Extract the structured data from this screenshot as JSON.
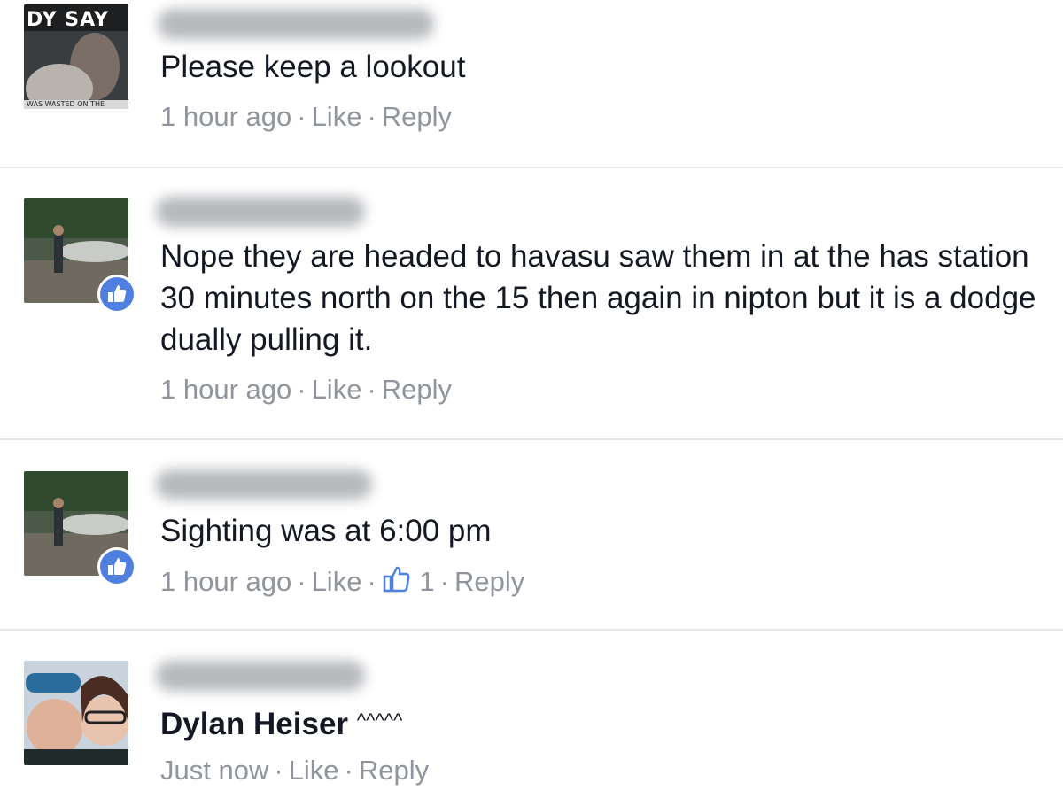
{
  "comments": [
    {
      "text": "Please keep a lookout",
      "time": "1 hour ago",
      "like": "Like",
      "reply": "Reply"
    },
    {
      "text": "Nope they are headed to havasu saw them in at the has station 30 minutes north on the 15 then again in nipton but it is a dodge dually pulling it.",
      "time": "1 hour ago",
      "like": "Like",
      "reply": "Reply"
    },
    {
      "text": "Sighting was at 6:00 pm",
      "time": "1 hour ago",
      "like": "Like",
      "reaction_count": "1",
      "reply": "Reply"
    },
    {
      "mention": "Dylan Heiser",
      "text": "^^^^^",
      "time": "Just now",
      "like": "Like",
      "reply": "Reply"
    }
  ],
  "avatar1_overlay_text": "DY SAY",
  "avatar1_caption": "WAS WASTED ON THE",
  "colors": {
    "meta": "#90949c",
    "like_badge": "#4f7fe0",
    "divider": "#e6e7ea"
  }
}
